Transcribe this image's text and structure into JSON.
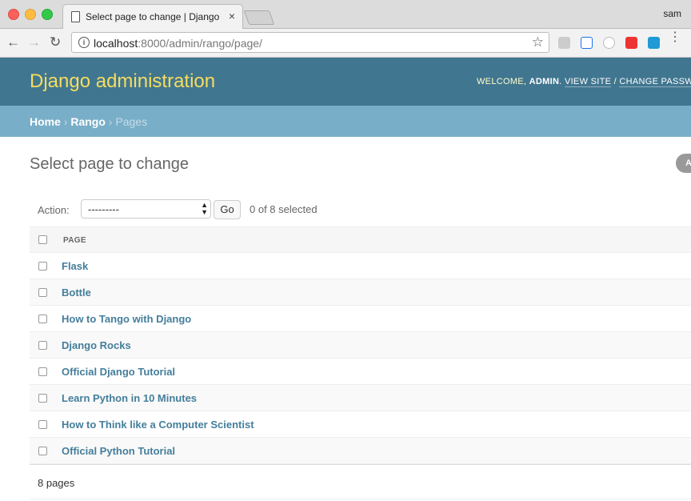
{
  "browser": {
    "tab_title": "Select page to change | Django site admin",
    "tab_close": "×",
    "profile_name": "sam",
    "url_host": "localhost",
    "url_rest": ":8000/admin/rango/page/",
    "back_icon": "←",
    "forward_icon": "→",
    "reload_icon": "↻",
    "star_icon": "☆",
    "info_icon": "i",
    "menu_icon": "⋮"
  },
  "header": {
    "branding": "Django administration",
    "welcome": "WELCOME, ",
    "username": "ADMIN",
    "view_site": "VIEW SITE",
    "separator": " / ",
    "change_password": "CHANGE PASSWORD"
  },
  "breadcrumbs": {
    "home": "Home",
    "app": "Rango",
    "current": "Pages",
    "sep": " › "
  },
  "content": {
    "title": "Select page to change",
    "add_button": "ADD PAGE +"
  },
  "actions": {
    "label": "Action:",
    "selected_option": "---------",
    "go": "Go",
    "selected_count": "0 of 8 selected"
  },
  "table": {
    "column_header": "PAGE",
    "rows": [
      "Flask",
      "Bottle",
      "How to Tango with Django",
      "Django Rocks",
      "Official Django Tutorial",
      "Learn Python in 10 Minutes",
      "How to Think like a Computer Scientist",
      "Official Python Tutorial"
    ]
  },
  "paginator": {
    "text": "8 pages"
  },
  "colors": {
    "header_bg": "#417690",
    "branding": "#f5dd5d",
    "breadcrumbs_bg": "#79aec8",
    "link": "#447e9b"
  }
}
